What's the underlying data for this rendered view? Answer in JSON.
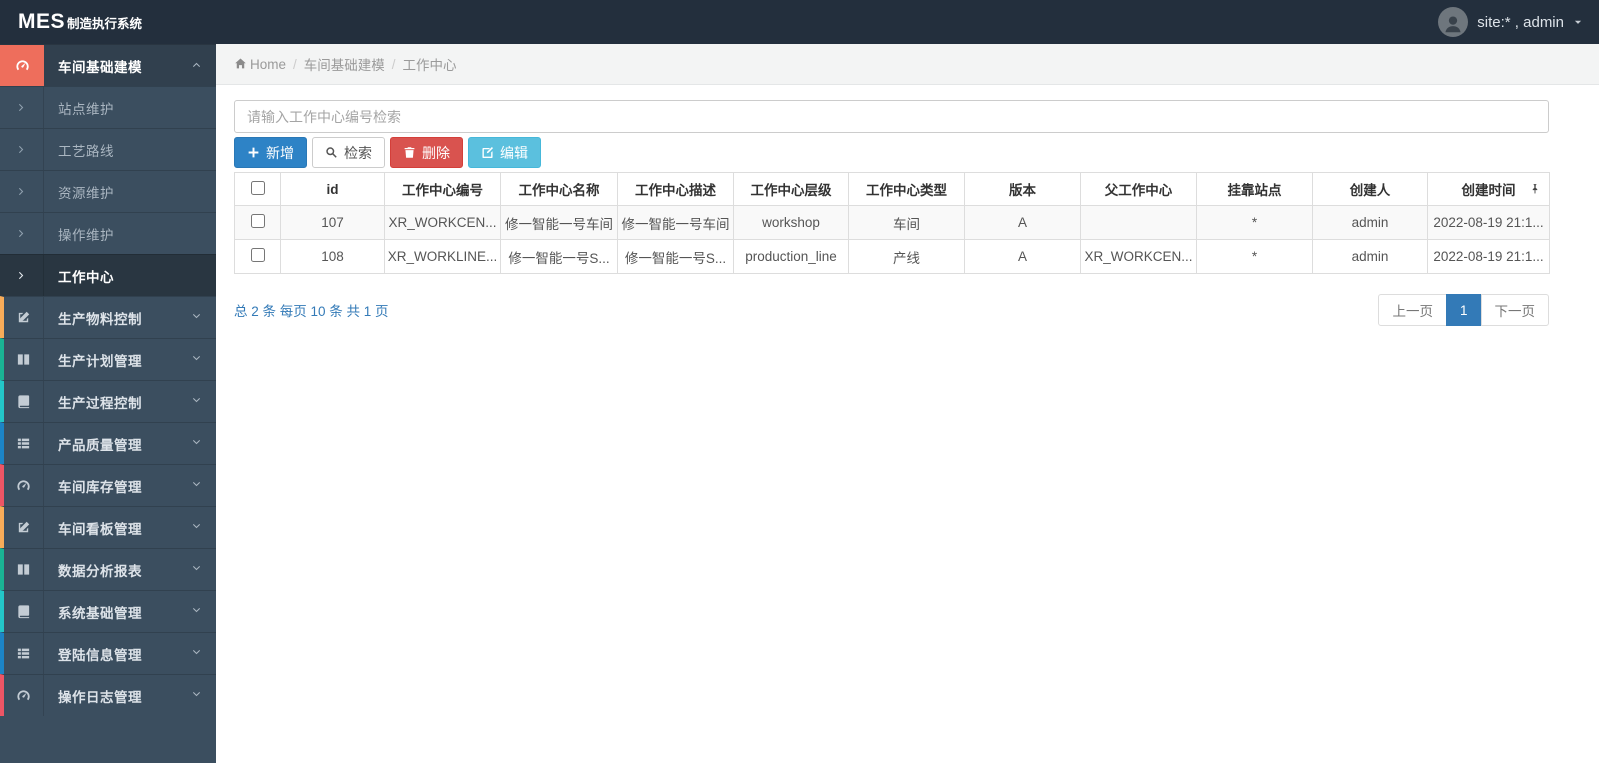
{
  "colors": {
    "topbar_bg": "#232f3d",
    "sidebar_bg": "#3b4e5f",
    "active_icon_bg": "#ee6e5c",
    "primary_blue": "#2e83c6",
    "danger_red": "#d9534f",
    "info_cyan": "#5bc0de",
    "link_blue": "#337ab7"
  },
  "topbar": {
    "brand_main": "MES",
    "brand_sub": "制造执行系统",
    "user_label": "site:* , admin"
  },
  "breadcrumb": {
    "home": "Home",
    "level1": "车间基础建模",
    "level2": "工作中心"
  },
  "sidebar": {
    "active_group": {
      "label": "车间基础建模"
    },
    "children": [
      {
        "label": "站点维护"
      },
      {
        "label": "工艺路线"
      },
      {
        "label": "资源维护"
      },
      {
        "label": "操作维护"
      },
      {
        "label": "工作中心"
      }
    ],
    "groups": [
      {
        "label": "生产物料控制",
        "icon": "pencil-square-icon",
        "strip": "#f8ac59"
      },
      {
        "label": "生产计划管理",
        "icon": "columns-icon",
        "strip": "#1ab394"
      },
      {
        "label": "生产过程控制",
        "icon": "book-icon",
        "strip": "#23c6c8"
      },
      {
        "label": "产品质量管理",
        "icon": "th-list-icon",
        "strip": "#1c84c6"
      },
      {
        "label": "车间库存管理",
        "icon": "dashboard-icon",
        "strip": "#ed5565"
      },
      {
        "label": "车间看板管理",
        "icon": "pencil-square-icon",
        "strip": "#f8ac59"
      },
      {
        "label": "数据分析报表",
        "icon": "columns-icon",
        "strip": "#1ab394"
      },
      {
        "label": "系统基础管理",
        "icon": "book-icon",
        "strip": "#23c6c8"
      },
      {
        "label": "登陆信息管理",
        "icon": "th-list-icon",
        "strip": "#1c84c6"
      },
      {
        "label": "操作日志管理",
        "icon": "dashboard-icon",
        "strip": "#ed5565"
      }
    ]
  },
  "search": {
    "placeholder": "请输入工作中心编号检索",
    "value": ""
  },
  "toolbar": {
    "add_label": "新增",
    "search_label": "检索",
    "delete_label": "删除",
    "edit_label": "编辑"
  },
  "table": {
    "headers": [
      "id",
      "工作中心编号",
      "工作中心名称",
      "工作中心描述",
      "工作中心层级",
      "工作中心类型",
      "版本",
      "父工作中心",
      "挂靠站点",
      "创建人",
      "创建时间"
    ],
    "rows": [
      [
        "107",
        "XR_WORKCEN...",
        "修一智能一号车间",
        "修一智能一号车间",
        "workshop",
        "车间",
        "A",
        "",
        "*",
        "admin",
        "2022-08-19 21:1..."
      ],
      [
        "108",
        "XR_WORKLINE...",
        "修一智能一号S...",
        "修一智能一号S...",
        "production_line",
        "产线",
        "A",
        "XR_WORKCEN...",
        "*",
        "admin",
        "2022-08-19 21:1..."
      ]
    ]
  },
  "pagination": {
    "summary": "总 2 条 每页 10 条 共 1 页",
    "prev_label": "上一页",
    "current_page": "1",
    "next_label": "下一页"
  }
}
